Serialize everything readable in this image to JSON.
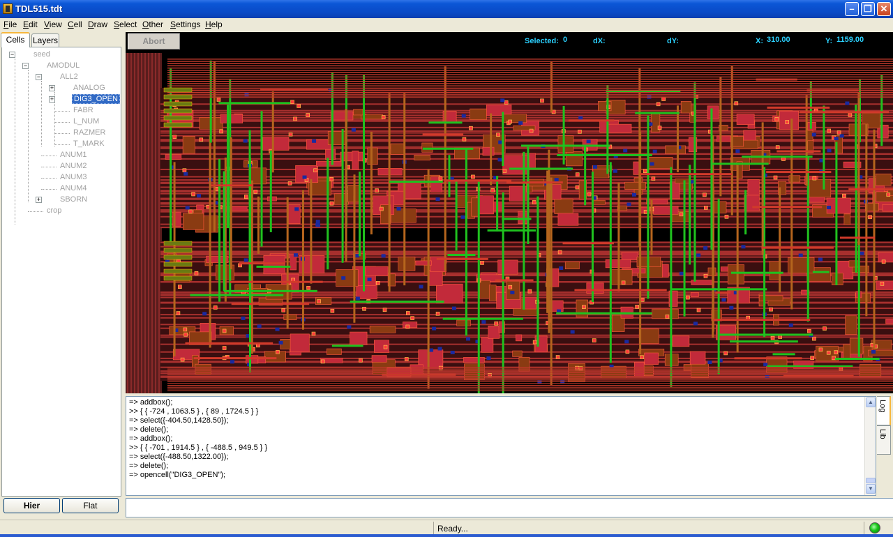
{
  "window": {
    "title": "TDL515.tdt"
  },
  "menu": [
    {
      "pre": "",
      "u": "F",
      "post": "ile"
    },
    {
      "pre": "",
      "u": "E",
      "post": "dit"
    },
    {
      "pre": "",
      "u": "V",
      "post": "iew"
    },
    {
      "pre": "",
      "u": "C",
      "post": "ell"
    },
    {
      "pre": "",
      "u": "D",
      "post": "raw"
    },
    {
      "pre": "",
      "u": "S",
      "post": "elect"
    },
    {
      "pre": "",
      "u": "O",
      "post": "ther"
    },
    {
      "pre": "",
      "u": "S",
      "post": "ettings"
    },
    {
      "pre": "",
      "u": "H",
      "post": "elp"
    }
  ],
  "left_tabs": [
    "Cells",
    "Layers"
  ],
  "tree": [
    {
      "label": "seed",
      "level": 0,
      "toggle": "minus"
    },
    {
      "label": "AMODUL",
      "level": 1,
      "toggle": "minus"
    },
    {
      "label": "ALL2",
      "level": 2,
      "toggle": "minus"
    },
    {
      "label": "ANALOG",
      "level": 3,
      "toggle": "plus"
    },
    {
      "label": "DIG3_OPEN",
      "level": 3,
      "toggle": "plus",
      "selected": true
    },
    {
      "label": "FABR",
      "level": 3,
      "toggle": ""
    },
    {
      "label": "L_NUM",
      "level": 3,
      "toggle": ""
    },
    {
      "label": "RAZMER",
      "level": 3,
      "toggle": ""
    },
    {
      "label": "T_MARK",
      "level": 3,
      "toggle": ""
    },
    {
      "label": "ANUM1",
      "level": 2,
      "toggle": ""
    },
    {
      "label": "ANUM2",
      "level": 2,
      "toggle": ""
    },
    {
      "label": "ANUM3",
      "level": 2,
      "toggle": ""
    },
    {
      "label": "ANUM4",
      "level": 2,
      "toggle": ""
    },
    {
      "label": "SBORN",
      "level": 2,
      "toggle": "plus"
    },
    {
      "label": "crop",
      "level": 1,
      "toggle": ""
    }
  ],
  "buttons": {
    "hier": "Hier",
    "flat": "Flat",
    "abort": "Abort"
  },
  "info": {
    "selected_label": "Selected:",
    "selected_value": "0",
    "dx_label": "dX:",
    "dx_value": "",
    "dy_label": "dY:",
    "dy_value": "",
    "x_label": "X:",
    "x_value": "310.00",
    "y_label": "Y:",
    "y_value": "1159.00"
  },
  "log_lines": [
    "=> addbox();",
    ">> { { -724 , 1063.5 } , { 89 , 1724.5 } }",
    "=> select({-404.50,1428.50});",
    "=> delete();",
    "=> addbox();",
    ">> { { -701 , 1914.5 } , { -488.5 , 949.5 } }",
    "=> select({-488.50,1322.00});",
    "=> delete();",
    "=> opencell(\"DIG3_OPEN\");"
  ],
  "side_tabs": [
    "Log",
    "Lib"
  ],
  "command_input": {
    "value": ""
  },
  "status": {
    "text": "Ready..."
  },
  "colors": {
    "canvas_bg": "#000000",
    "info_text": "#2bd1ff",
    "metal1": "#c0392b",
    "poly": "#1fc21f",
    "contact": "#ff3b3b",
    "diffusion": "#b5651d"
  }
}
